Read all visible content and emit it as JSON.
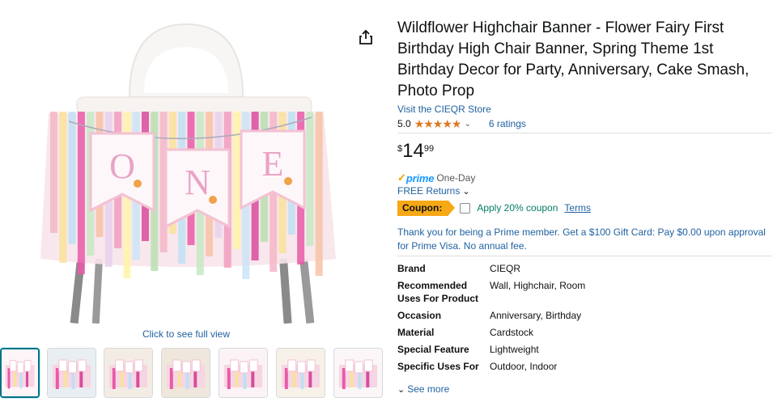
{
  "product": {
    "title": "Wildflower Highchair Banner - Flower Fairy First Birthday High Chair Banner, Spring Theme 1st Birthday Decor for Party, Anniversary, Cake Smash, Photo Prop",
    "store_link": "Visit the CIEQR Store",
    "rating_value": "5.0",
    "stars": "★★★★★",
    "ratings_count": "6 ratings",
    "price": {
      "symbol": "$",
      "whole": "14",
      "fraction": "99"
    },
    "prime_check": "✓",
    "prime_label": "prime",
    "prime_delivery": "One-Day",
    "returns": "FREE Returns",
    "coupon": {
      "badge": "Coupon:",
      "text": "Apply 20% coupon",
      "terms": "Terms"
    },
    "promo": "Thank you for being a Prime member. Get a $100 Gift Card: Pay $0.00 upon approval for Prime Visa. No annual fee.",
    "see_more": "See more"
  },
  "specs": [
    {
      "key": "Brand",
      "value": "CIEQR"
    },
    {
      "key": "Recommended Uses For Product",
      "value": "Wall, Highchair, Room"
    },
    {
      "key": "Occasion",
      "value": "Anniversary, Birthday"
    },
    {
      "key": "Material",
      "value": "Cardstock"
    },
    {
      "key": "Special Feature",
      "value": "Lightweight"
    },
    {
      "key": "Specific Uses For Product",
      "value": "Outdoor, Indoor"
    }
  ],
  "gallery": {
    "full_view_label": "Click to see full view",
    "banner_letters": [
      "O",
      "N",
      "E"
    ],
    "thumbnails": [
      {
        "name": "thumb-1",
        "active": true
      },
      {
        "name": "thumb-2",
        "active": false
      },
      {
        "name": "thumb-3",
        "active": false
      },
      {
        "name": "thumb-4",
        "active": false
      },
      {
        "name": "thumb-5",
        "active": false
      },
      {
        "name": "thumb-6",
        "active": false
      },
      {
        "name": "thumb-7",
        "active": false
      }
    ]
  },
  "icons": {
    "share": "share-icon",
    "caret": "chevron-down-icon"
  },
  "colors": {
    "link": "#2162a1",
    "star": "#de7921",
    "coupon": "#f7a815",
    "coupon_text": "#067d62",
    "prime": "#1399ff"
  }
}
